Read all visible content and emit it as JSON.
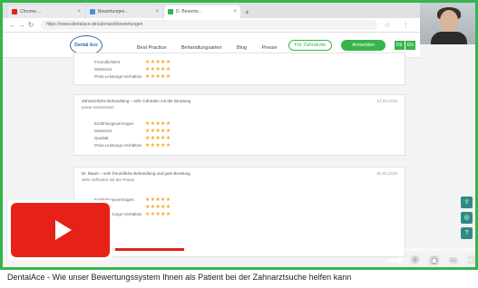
{
  "browser": {
    "tabs": [
      {
        "label": "Chrome ...",
        "active": false,
        "favicon": "#e62117"
      },
      {
        "label": "Bewertungen...",
        "active": false,
        "favicon": "#4a90d9"
      },
      {
        "label": "D. Bewerte...",
        "active": true,
        "favicon": "#36b54a"
      }
    ],
    "url": "https://www.dentalace.de/zahnarzt/bewertungen",
    "nav_icons": [
      "back-icon",
      "forward-icon",
      "reload-icon"
    ]
  },
  "site": {
    "logo_text": "Dental Ace",
    "nav": [
      "Best Practice",
      "Behandlungsarten",
      "Blog",
      "Presse"
    ],
    "cta_outline": "Für Zahnärzte",
    "cta_primary": "Anmelden",
    "langs": [
      "DE",
      "EN"
    ]
  },
  "reviews": [
    {
      "title": "",
      "subtitle": "",
      "date": "",
      "rows": [
        {
          "label": "Freundlichkeit",
          "stars": "★★★★★"
        },
        {
          "label": "Wartezeit",
          "stars": "★★★★★"
        },
        {
          "label": "Preis-Leistungs-Verhältnis",
          "stars": "★★★★★"
        }
      ]
    },
    {
      "title": "Zahnärztliche Behandlung – sehr zufrieden mit der Beratung",
      "subtitle": "Keine Schmerzen",
      "date": "12.02.2019",
      "rows": [
        {
          "label": "Einfühlungsvermögen",
          "stars": "★★★★★"
        },
        {
          "label": "Wartezeit",
          "stars": "★★★★★"
        },
        {
          "label": "Qualität",
          "stars": "★★★★★"
        },
        {
          "label": "Preis-Leistungs-Verhältnis",
          "stars": "★★★★★"
        }
      ]
    },
    {
      "title": "Dr. Bauer – sehr freundliche Behandlung und gute Beratung",
      "subtitle": "Sehr zufrieden mit der Praxis",
      "date": "02.02.2019",
      "rows": [
        {
          "label": "Einfühlungsvermögen",
          "stars": "★★★★★"
        },
        {
          "label": "Wartezeit",
          "stars": "★★★★★"
        },
        {
          "label": "Preis-Leistungs-Verhältnis",
          "stars": "★★★★★"
        }
      ]
    }
  ],
  "video": {
    "progress_fraction": 0.19,
    "controls": [
      "volume-icon",
      "settings-icon",
      "miniplayer-icon",
      "theater-icon",
      "fullscreen-icon"
    ]
  },
  "caption": "DentalAce - Wie unser Bewertungssystem Ihnen als Patient bei der Zahnarztsuche helfen kann"
}
